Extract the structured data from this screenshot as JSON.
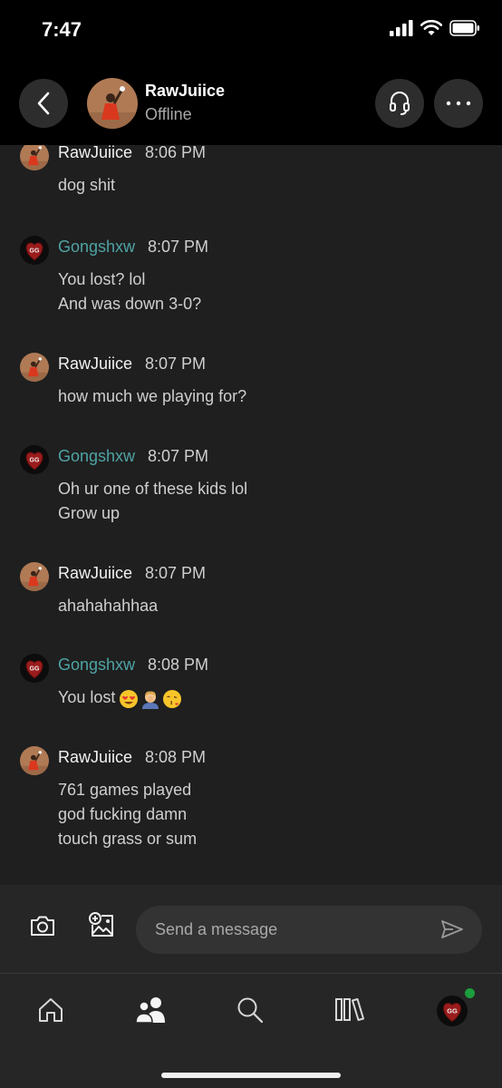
{
  "status": {
    "time": "7:47"
  },
  "header": {
    "name": "RawJuiice",
    "presence": "Offline"
  },
  "messages": [
    {
      "sender": "RawJuiice",
      "time": "8:06 PM",
      "lines": [
        "dog shit"
      ]
    },
    {
      "sender": "Gongshxw",
      "time": "8:07 PM",
      "lines": [
        "You lost? lol",
        "And was down 3-0?"
      ]
    },
    {
      "sender": "RawJuiice",
      "time": "8:07 PM",
      "lines": [
        "how much we playing for?"
      ]
    },
    {
      "sender": "Gongshxw",
      "time": "8:07 PM",
      "lines": [
        "Oh ur one of these kids lol",
        "Grow up"
      ]
    },
    {
      "sender": "RawJuiice",
      "time": "8:07 PM",
      "lines": [
        "ahahahahhaa"
      ]
    },
    {
      "sender": "Gongshxw",
      "time": "8:08 PM",
      "lines": [
        "You lost"
      ],
      "emojis": [
        "heart-eyes-emoji",
        "person-facepalm-emoji",
        "face-blowing-kiss-emoji"
      ]
    },
    {
      "sender": "RawJuiice",
      "time": "8:08 PM",
      "lines": [
        "761 games played",
        "god fucking damn",
        "touch grass or sum"
      ]
    }
  ],
  "composer": {
    "placeholder": "Send a message"
  },
  "nav": {
    "items": [
      "home-icon",
      "social-icon",
      "search-icon",
      "library-icon",
      "profile-avatar"
    ]
  },
  "colors": {
    "gamertag_teal": "#4fa3a5",
    "online_green": "#1c9d3c",
    "background": "#1f1f1f"
  },
  "avatars": {
    "gamerpic_badge": "GG"
  }
}
